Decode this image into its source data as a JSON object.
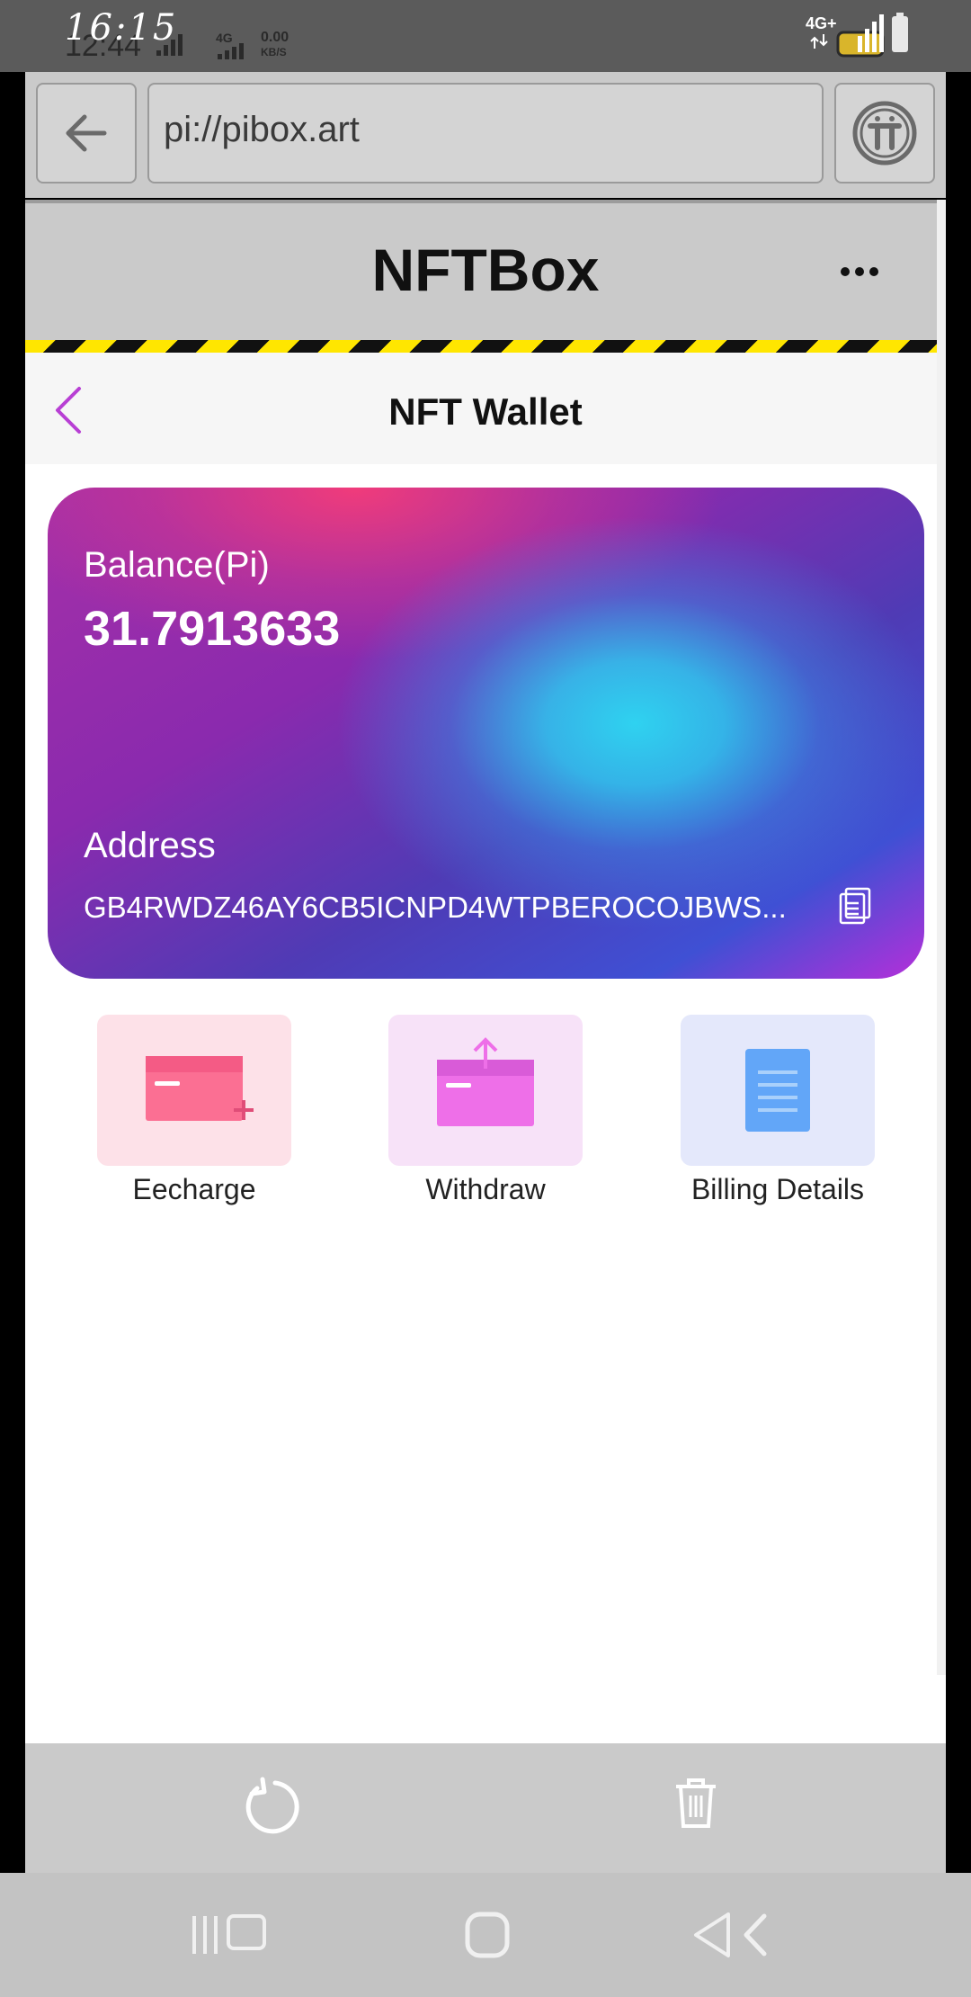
{
  "status_bar": {
    "time": "16:15",
    "time_shadow": "12:44",
    "network_type": "4G",
    "speed_value": "0.00",
    "speed_unit": "KB/S",
    "network_badge": "4G+"
  },
  "browser": {
    "url": "pi://pibox.art",
    "back_icon": "arrow-left-icon",
    "pi_icon": "pi-logo-icon"
  },
  "app": {
    "title": "NFTBox",
    "more_icon": "more-dots-icon"
  },
  "wallet": {
    "page_title": "NFT Wallet",
    "balance_label": "Balance(Pi)",
    "balance_value": "31.7913633",
    "address_label": "Address",
    "address_value": "GB4RWDZ46AY6CB5ICNPD4WTPBEROCOJBWS...",
    "copy_icon": "copy-icon"
  },
  "actions": [
    {
      "label": "Eecharge",
      "icon": "card-plus-icon",
      "color": "#fb6f93"
    },
    {
      "label": "Withdraw",
      "icon": "card-upload-icon",
      "color": "#ee6fe8"
    },
    {
      "label": "Billing Details",
      "icon": "document-list-icon",
      "color": "#62a6f8"
    }
  ],
  "toolbar": {
    "reload_icon": "reload-icon",
    "delete_icon": "trash-icon"
  },
  "colors": {
    "accent": "#b83fd4",
    "card_gradient_start": "#a530a8",
    "card_gradient_center": "#2fd2f0",
    "hazard_yellow": "#ffe600"
  }
}
